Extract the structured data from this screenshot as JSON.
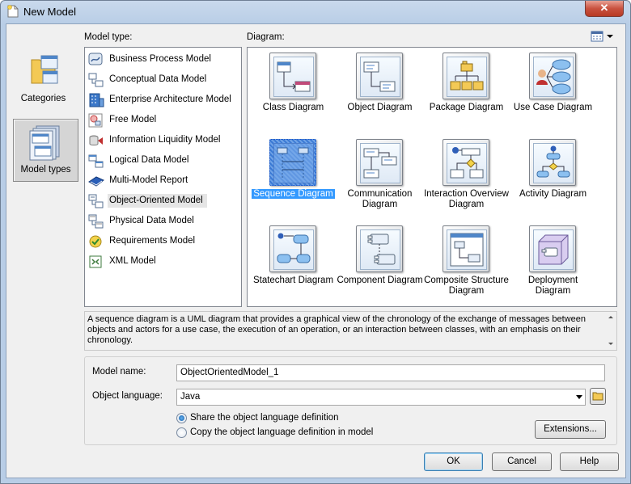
{
  "window": {
    "title": "New Model",
    "close_glyph": "✕"
  },
  "categories": [
    {
      "label": "Categories",
      "icon": "folder-windows-icon",
      "selected": false
    },
    {
      "label": "Model types",
      "icon": "stacked-windows-icon",
      "selected": true
    }
  ],
  "model_type": {
    "label": "Model type:",
    "items": [
      {
        "label": "Business Process Model",
        "icon": "business-process-icon"
      },
      {
        "label": "Conceptual Data Model",
        "icon": "conceptual-data-icon"
      },
      {
        "label": "Enterprise Architecture Model",
        "icon": "enterprise-architecture-icon"
      },
      {
        "label": "Free Model",
        "icon": "free-model-icon"
      },
      {
        "label": "Information Liquidity Model",
        "icon": "information-liquidity-icon"
      },
      {
        "label": "Logical Data Model",
        "icon": "logical-data-icon"
      },
      {
        "label": "Multi-Model Report",
        "icon": "report-book-icon"
      },
      {
        "label": "Object-Oriented Model",
        "icon": "object-oriented-icon",
        "selected": true
      },
      {
        "label": "Physical Data Model",
        "icon": "physical-data-icon"
      },
      {
        "label": "Requirements Model",
        "icon": "requirements-icon"
      },
      {
        "label": "XML Model",
        "icon": "xml-model-icon"
      }
    ]
  },
  "diagram": {
    "label": "Diagram:",
    "view_icon": "list-view-icon",
    "items": [
      {
        "label": "Class Diagram",
        "icon": "class-diagram-icon"
      },
      {
        "label": "Object Diagram",
        "icon": "object-diagram-icon"
      },
      {
        "label": "Package Diagram",
        "icon": "package-diagram-icon"
      },
      {
        "label": "Use Case Diagram",
        "icon": "use-case-diagram-icon"
      },
      {
        "label": "Sequence Diagram",
        "icon": "sequence-diagram-icon",
        "selected": true
      },
      {
        "label": "Communication Diagram",
        "icon": "communication-diagram-icon"
      },
      {
        "label": "Interaction Overview Diagram",
        "icon": "interaction-overview-icon"
      },
      {
        "label": "Activity Diagram",
        "icon": "activity-diagram-icon"
      },
      {
        "label": "Statechart Diagram",
        "icon": "statechart-diagram-icon"
      },
      {
        "label": "Component Diagram",
        "icon": "component-diagram-icon"
      },
      {
        "label": "Composite Structure Diagram",
        "icon": "composite-structure-icon"
      },
      {
        "label": "Deployment Diagram",
        "icon": "deployment-diagram-icon"
      }
    ]
  },
  "description": "A sequence diagram is a UML diagram that provides a graphical view of the chronology of the exchange of messages between objects and actors for a use case, the execution of an operation, or an interaction between classes, with an emphasis on their chronology.",
  "form": {
    "model_name_label": "Model name:",
    "model_name_value": "ObjectOrientedModel_1",
    "object_language_label": "Object language:",
    "object_language_value": "Java",
    "share_option": "Share the object language definition",
    "copy_option": "Copy the object language definition in model",
    "extensions_button": "Extensions..."
  },
  "buttons": {
    "ok": "OK",
    "cancel": "Cancel",
    "help": "Help"
  },
  "colors": {
    "selection": "#3399ff",
    "title_gradient_top": "#c9d9ec",
    "close_red": "#c9523f"
  }
}
